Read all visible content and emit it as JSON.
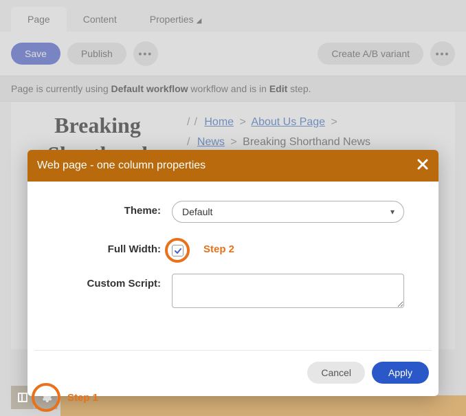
{
  "tabs": {
    "page": "Page",
    "content": "Content",
    "properties": "Properties"
  },
  "toolbar": {
    "save": "Save",
    "publish": "Publish",
    "create_ab": "Create A/B variant"
  },
  "status": {
    "prefix": "Page is currently using ",
    "workflow_name": "Default workflow",
    "mid": " workflow and is in ",
    "step_name": "Edit",
    "suffix": " step."
  },
  "page_title": "Breaking Shorthand",
  "breadcrumbs": {
    "home": "Home",
    "about": "About Us Page",
    "news": "News",
    "current": "Breaking Shorthand News"
  },
  "modal": {
    "title": "Web page - one column properties",
    "theme_label": "Theme:",
    "theme_value": "Default",
    "fullwidth_label": "Full Width:",
    "fullwidth_checked": true,
    "script_label": "Custom Script:",
    "script_value": "",
    "cancel": "Cancel",
    "apply": "Apply"
  },
  "annotations": {
    "step1": "Step 1",
    "step2": "Step 2"
  },
  "colors": {
    "accent_blue": "#4a5fd0",
    "modal_header": "#b86a0c",
    "annotation": "#e8711a"
  }
}
